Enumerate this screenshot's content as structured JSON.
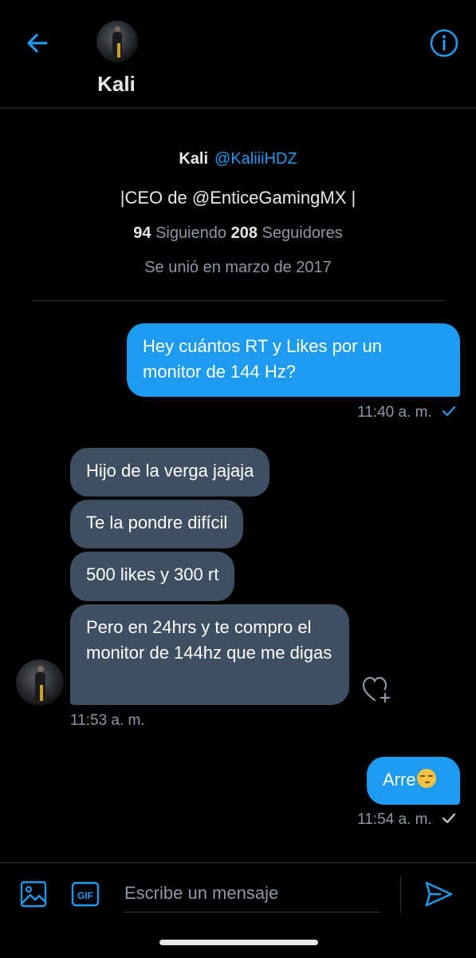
{
  "header": {
    "title": "Kali",
    "back_icon": "arrow-left-icon",
    "info_icon": "info-icon",
    "accent": "#1d9bf0"
  },
  "profile": {
    "name": "Kali",
    "handle": "@KaliiiHDZ",
    "bio": "|CEO de @EnticeGamingMX |",
    "following_count": "94",
    "following_label": "Siguiendo",
    "followers_count": "208",
    "followers_label": "Seguidores",
    "joined": "Se unió en marzo de 2017"
  },
  "messages": [
    {
      "direction": "out",
      "text": "Hey cuántos RT y Likes por un monitor de 144 Hz?"
    },
    {
      "direction": "in",
      "text": "Hijo de la verga jajaja"
    },
    {
      "direction": "in",
      "text": "Te la pondre difícil"
    },
    {
      "direction": "in",
      "text": "500 likes y 300 rt"
    },
    {
      "direction": "in",
      "text": "Pero en 24hrs y te compro el monitor de 144hz que me digas"
    },
    {
      "direction": "out",
      "text": "Arre",
      "emoji": "smirk-emoji"
    }
  ],
  "timestamps": {
    "t1": "11:40 a. m.",
    "t2": "11:53 a. m.",
    "t3": "11:54 a. m."
  },
  "composer": {
    "placeholder": "Escribe un mensaje",
    "gif_label": "GIF",
    "media_icon": "image-icon",
    "send_icon": "send-icon"
  },
  "colors": {
    "background": "#000000",
    "outgoing_bubble": "#1d9bf0",
    "incoming_bubble": "#3d4f61",
    "muted_text": "#8b98a5"
  }
}
